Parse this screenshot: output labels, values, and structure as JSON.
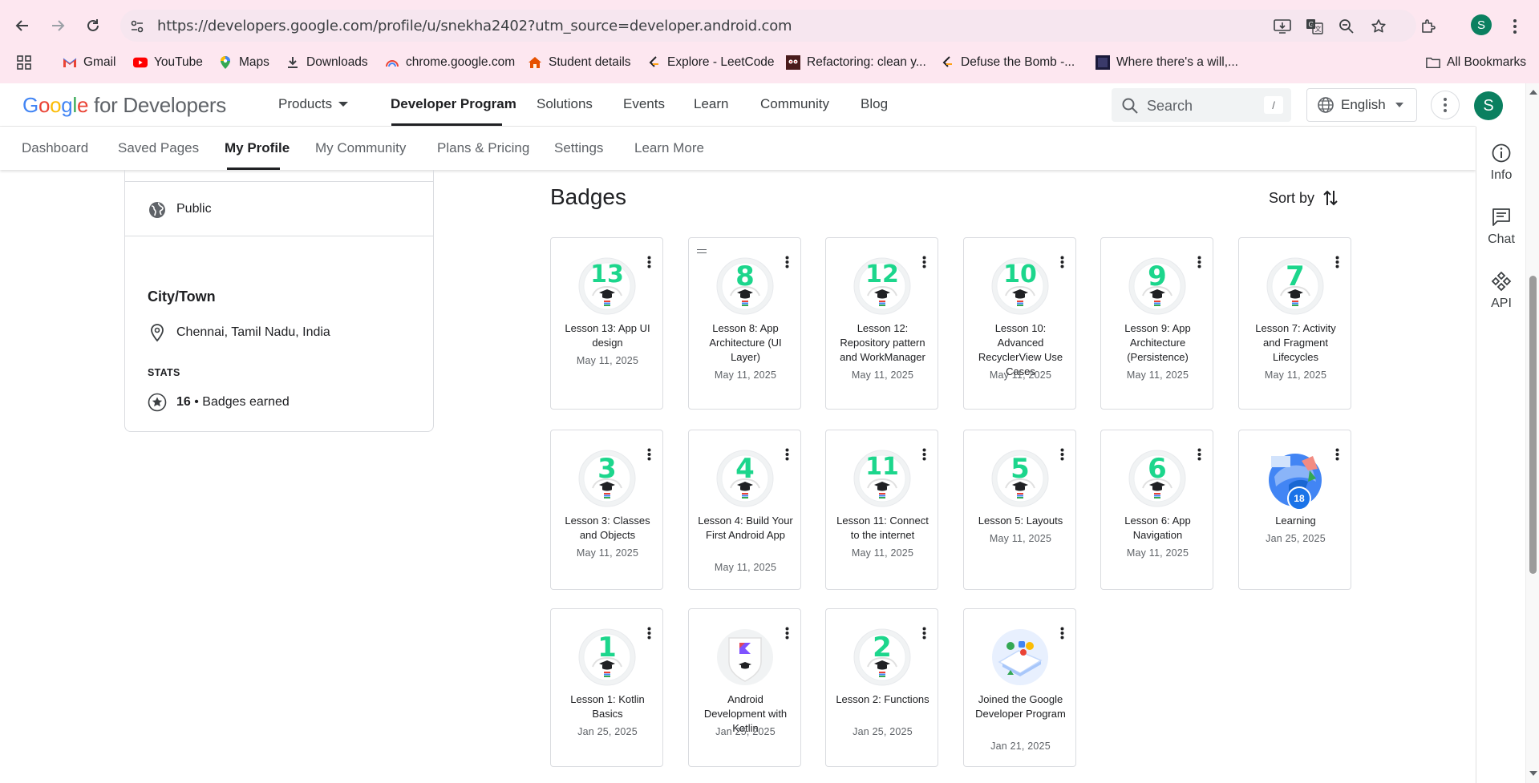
{
  "browser": {
    "url": "https://developers.google.com/profile/u/snekha2402?utm_source=developer.android.com",
    "profile_initial": "S",
    "bookmarks": [
      {
        "label": "Gmail",
        "icon": "gmail-icon"
      },
      {
        "label": "YouTube",
        "icon": "youtube-icon"
      },
      {
        "label": "Maps",
        "icon": "maps-icon"
      },
      {
        "label": "Downloads",
        "icon": "download-icon"
      },
      {
        "label": "chrome.google.com",
        "icon": "rainbow-icon"
      },
      {
        "label": "Student details",
        "icon": "home-icon"
      },
      {
        "label": "Explore - LeetCode",
        "icon": "leetcode-icon"
      },
      {
        "label": "Refactoring: clean y...",
        "icon": "refactoring-icon"
      },
      {
        "label": "Defuse the Bomb -...",
        "icon": "leetcode-icon"
      },
      {
        "label": "Where there's a will,...",
        "icon": "page-icon"
      }
    ],
    "all_bookmarks": "All Bookmarks"
  },
  "header": {
    "logo_google": "Google",
    "logo_rest": " for Developers",
    "nav": [
      "Products",
      "Developer Program",
      "Solutions",
      "Events",
      "Learn",
      "Community",
      "Blog"
    ],
    "active_nav": "Developer Program",
    "search_placeholder": "Search",
    "search_shortcut": "/",
    "language": "English",
    "avatar_initial": "S"
  },
  "subnav": {
    "tabs": [
      "Dashboard",
      "Saved Pages",
      "My Profile",
      "My Community",
      "Plans & Pricing",
      "Settings",
      "Learn More"
    ],
    "active": "My Profile"
  },
  "rail": {
    "items": [
      {
        "label": "Info",
        "icon": "info-icon"
      },
      {
        "label": "Chat",
        "icon": "chat-icon"
      },
      {
        "label": "API",
        "icon": "api-icon"
      }
    ]
  },
  "profile": {
    "visibility": "Public",
    "city_heading": "City/Town",
    "city": "Chennai, Tamil Nadu, India",
    "stats_heading": "STATS",
    "badges_count": "16",
    "badges_label": " • Badges earned"
  },
  "badges": {
    "title": "Badges",
    "sort_label": "Sort by",
    "items": [
      {
        "number": "13",
        "title": "Lesson 13: App UI design",
        "date": "May 11, 2025",
        "kind": "lesson"
      },
      {
        "number": "8",
        "title": "Lesson 8: App Architecture (UI Layer)",
        "date": "May 11, 2025",
        "kind": "lesson"
      },
      {
        "number": "12",
        "title": "Lesson 12: Repository pattern and WorkManager",
        "date": "May 11, 2025",
        "kind": "lesson"
      },
      {
        "number": "10",
        "title": "Lesson 10: Advanced RecyclerView Use Cases",
        "date": "May 11, 2025",
        "kind": "lesson"
      },
      {
        "number": "9",
        "title": "Lesson 9: App Architecture (Persistence)",
        "date": "May 11, 2025",
        "kind": "lesson"
      },
      {
        "number": "7",
        "title": "Lesson 7: Activity and Fragment Lifecycles",
        "date": "May 11, 2025",
        "kind": "lesson"
      },
      {
        "number": "3",
        "title": "Lesson 3: Classes and Objects",
        "date": "May 11, 2025",
        "kind": "lesson"
      },
      {
        "number": "4",
        "title": "Lesson 4: Build Your First Android App",
        "date": "May 11, 2025",
        "kind": "lesson"
      },
      {
        "number": "11",
        "title": "Lesson 11: Connect to the internet",
        "date": "May 11, 2025",
        "kind": "lesson"
      },
      {
        "number": "5",
        "title": "Lesson 5: Layouts",
        "date": "May 11, 2025",
        "kind": "lesson"
      },
      {
        "number": "6",
        "title": "Lesson 6: App Navigation",
        "date": "May 11, 2025",
        "kind": "lesson"
      },
      {
        "number": "18",
        "title": "Learning",
        "date": "Jan 25, 2025",
        "kind": "learning"
      },
      {
        "number": "1",
        "title": "Lesson 1: Kotlin Basics",
        "date": "Jan 25, 2025",
        "kind": "lesson"
      },
      {
        "number": "",
        "title": "Android Development with Kotlin",
        "date": "Jan 25, 2025",
        "kind": "kotlin"
      },
      {
        "number": "2",
        "title": "Lesson 2: Functions",
        "date": "Jan 25, 2025",
        "kind": "lesson"
      },
      {
        "number": "",
        "title": "Joined the Google Developer Program",
        "date": "Jan 21, 2025",
        "kind": "joined"
      }
    ]
  },
  "colors": {
    "badge_number": "#1cd68c",
    "avatar": "#0b8060",
    "chrome_bg": "#fde7f0"
  }
}
